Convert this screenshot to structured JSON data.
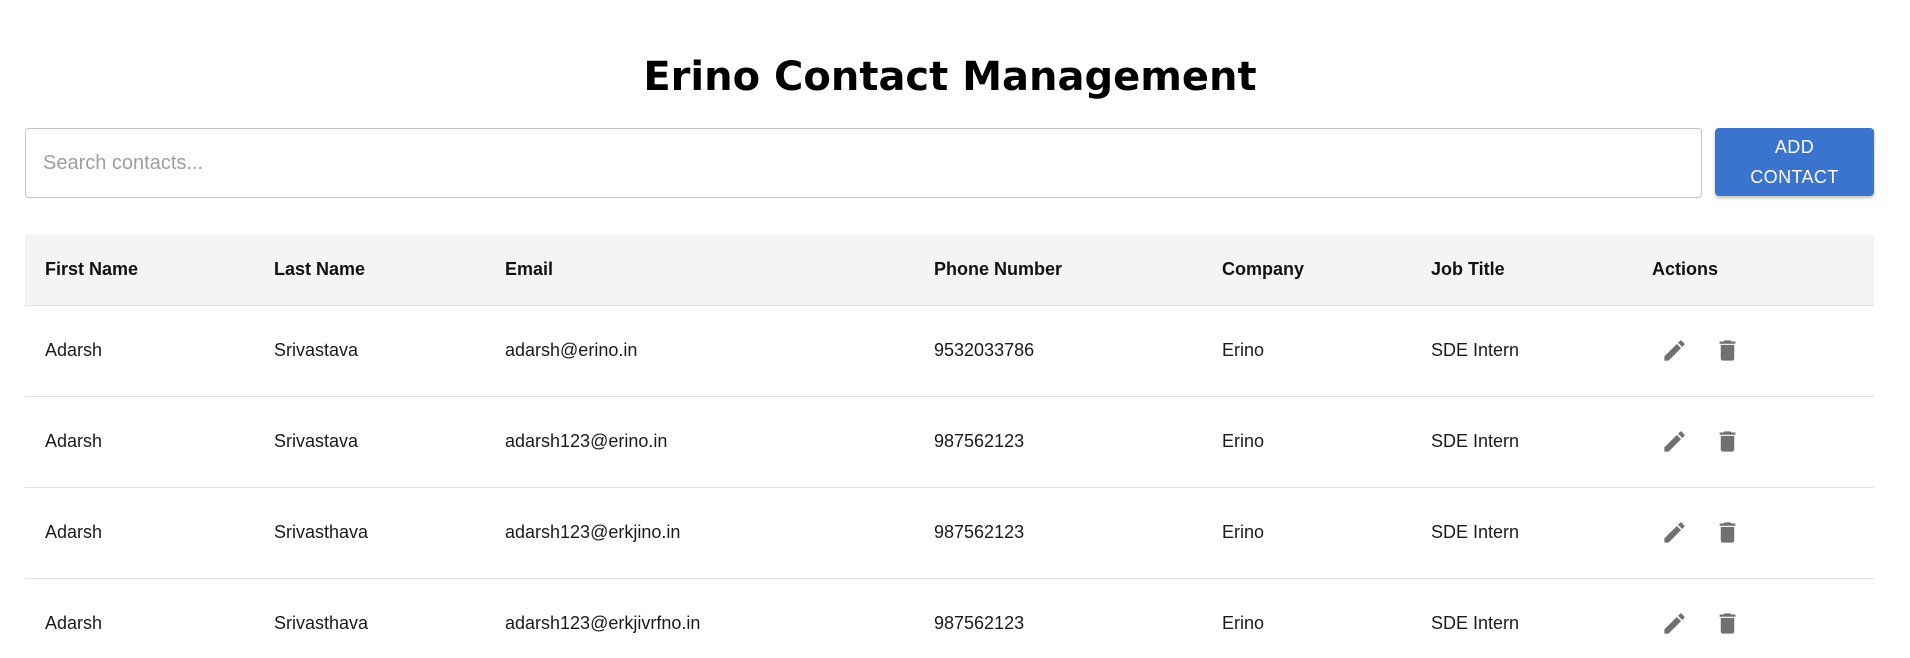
{
  "page": {
    "title": "Erino Contact Management"
  },
  "toolbar": {
    "search_placeholder": "Search contacts...",
    "search_value": "",
    "add_label": "ADD CONTACT"
  },
  "table": {
    "headers": [
      "First Name",
      "Last Name",
      "Email",
      "Phone Number",
      "Company",
      "Job Title",
      "Actions"
    ],
    "rows": [
      [
        "Adarsh",
        "Srivastava",
        "adarsh@erino.in",
        "9532033786",
        "Erino",
        "SDE Intern"
      ],
      [
        "Adarsh",
        "Srivastava",
        "adarsh123@erino.in",
        "987562123",
        "Erino",
        "SDE Intern"
      ],
      [
        "Adarsh",
        "Srivasthava",
        "adarsh123@erkjino.in",
        "987562123",
        "Erino",
        "SDE Intern"
      ],
      [
        "Adarsh",
        "Srivasthava",
        "adarsh123@erkjivrfno.in",
        "987562123",
        "Erino",
        "SDE Intern"
      ]
    ],
    "row_actions": [
      "edit-icon",
      "delete-icon"
    ]
  },
  "colors": {
    "accent": "#3a74cf",
    "header_bg": "#f4f4f4",
    "icon": "#707070",
    "border": "#e0e0e0"
  }
}
